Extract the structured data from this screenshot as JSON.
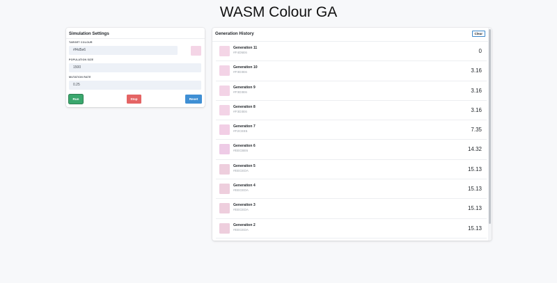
{
  "header": {
    "title": "WASM Colour GA"
  },
  "settings": {
    "title": "Simulation Settings",
    "target_label": "TARGET COLOUR",
    "target_value": "#f4d5e6",
    "target_swatch_color": "#f4d5e6",
    "population_label": "POPULATION SIZE",
    "population_value": "1500",
    "mutation_label": "MUTATION RATE",
    "mutation_value": "0.25",
    "buttons": {
      "run": {
        "label": "Run",
        "color": "#3aa76d"
      },
      "stop": {
        "label": "Stop",
        "color": "#e46464"
      },
      "reset": {
        "label": "Reset",
        "color": "#3f8fd4"
      }
    }
  },
  "history": {
    "title": "Generation History",
    "clear_label": "Clear",
    "rows": [
      {
        "name": "Generation 11",
        "hex": "#F4D5E6",
        "fitness": "0",
        "color": "#f4d5e6"
      },
      {
        "name": "Generation 10",
        "hex": "#F3D3E6",
        "fitness": "3.16",
        "color": "#f3d3e6"
      },
      {
        "name": "Generation 9",
        "hex": "#F3D3E6",
        "fitness": "3.16",
        "color": "#f3d3e6"
      },
      {
        "name": "Generation 8",
        "hex": "#F3D3E6",
        "fitness": "3.16",
        "color": "#f3d3e6"
      },
      {
        "name": "Generation 7",
        "hex": "#F2CEE5",
        "fitness": "7.35",
        "color": "#f2cee5"
      },
      {
        "name": "Generation 6",
        "hex": "#EECBE6",
        "fitness": "14.32",
        "color": "#eecbe6"
      },
      {
        "name": "Generation 5",
        "hex": "#EECEDA",
        "fitness": "15.13",
        "color": "#eecedd"
      },
      {
        "name": "Generation 4",
        "hex": "#EECEDA",
        "fitness": "15.13",
        "color": "#eecedd"
      },
      {
        "name": "Generation 3",
        "hex": "#EECEDA",
        "fitness": "15.13",
        "color": "#eecedd"
      },
      {
        "name": "Generation 2",
        "hex": "#EECEDA",
        "fitness": "15.13",
        "color": "#eecedd"
      }
    ]
  }
}
